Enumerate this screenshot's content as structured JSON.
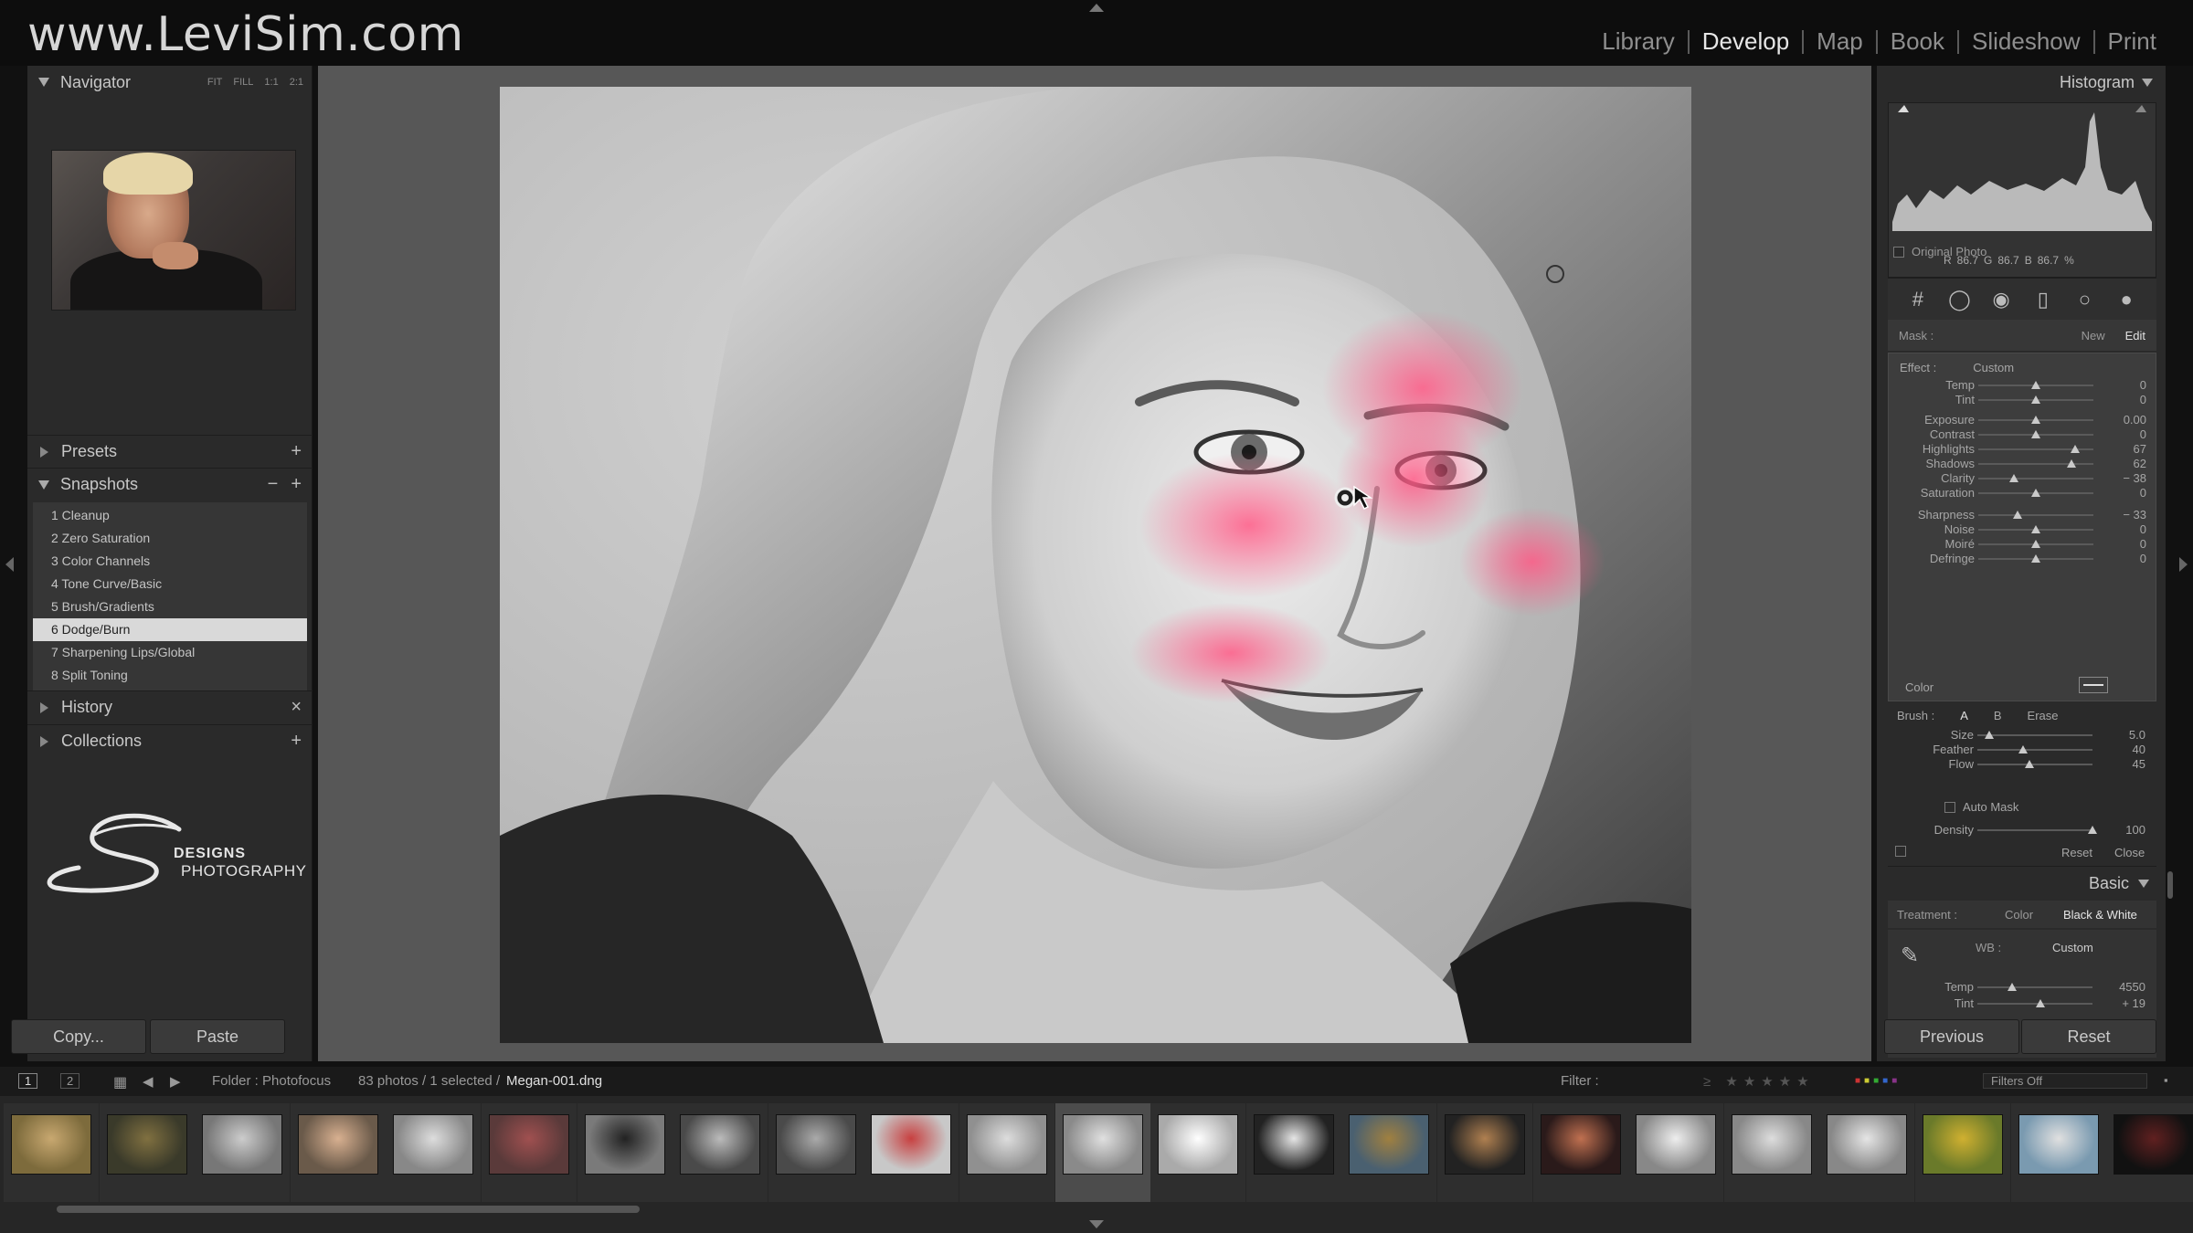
{
  "brand": "www.LeviSim.com",
  "modules": [
    "Library",
    "Develop",
    "Map",
    "Book",
    "Slideshow",
    "Print"
  ],
  "active_module": "Develop",
  "left_panel": {
    "navigator": {
      "title": "Navigator",
      "zoom_options": [
        "FIT",
        "FILL",
        "1:1",
        "2:1"
      ]
    },
    "presets": {
      "title": "Presets",
      "action": "+"
    },
    "snapshots": {
      "title": "Snapshots",
      "actions": [
        "−",
        "+"
      ],
      "items": [
        "1 Cleanup",
        "2 Zero Saturation",
        "3 Color Channels",
        "4 Tone Curve/Basic",
        "5 Brush/Gradients",
        "6 Dodge/Burn",
        "7 Sharpening Lips/Global",
        "8 Split Toning"
      ],
      "selected_index": 5
    },
    "history": {
      "title": "History",
      "action": "×"
    },
    "collections": {
      "title": "Collections",
      "action": "+"
    },
    "logo": {
      "line1": "DESIGNS",
      "line2": "PHOTOGRAPHY"
    },
    "copy_label": "Copy...",
    "paste_label": "Paste"
  },
  "right_panel": {
    "histogram": {
      "title": "Histogram",
      "readout": {
        "r_label": "R",
        "r": "86.7",
        "g_label": "G",
        "g": "86.7",
        "b_label": "B",
        "b": "86.7",
        "unit": "%"
      },
      "original_photo": "Original Photo"
    },
    "mask": {
      "label": "Mask :",
      "new": "New",
      "edit": "Edit"
    },
    "effect": {
      "label": "Effect :",
      "value": "Custom"
    },
    "sliders": [
      {
        "label": "Temp",
        "value": "0",
        "pos": 0.5
      },
      {
        "label": "Tint",
        "value": "0",
        "pos": 0.5
      },
      {
        "label": "Exposure",
        "value": "0.00",
        "pos": 0.5
      },
      {
        "label": "Contrast",
        "value": "0",
        "pos": 0.5
      },
      {
        "label": "Highlights",
        "value": "67",
        "pos": 0.84
      },
      {
        "label": "Shadows",
        "value": "62",
        "pos": 0.81
      },
      {
        "label": "Clarity",
        "value": "− 38",
        "pos": 0.31
      },
      {
        "label": "Saturation",
        "value": "0",
        "pos": 0.5
      },
      {
        "label": "Sharpness",
        "value": "− 33",
        "pos": 0.34
      },
      {
        "label": "Noise",
        "value": "0",
        "pos": 0.5
      },
      {
        "label": "Moiré",
        "value": "0",
        "pos": 0.5
      },
      {
        "label": "Defringe",
        "value": "0",
        "pos": 0.5
      }
    ],
    "color_label": "Color",
    "brush": {
      "label": "Brush :",
      "a": "A",
      "b": "B",
      "erase": "Erase",
      "sliders": [
        {
          "label": "Size",
          "value": "5.0",
          "pos": 0.1
        },
        {
          "label": "Feather",
          "value": "40",
          "pos": 0.4
        },
        {
          "label": "Flow",
          "value": "45",
          "pos": 0.45
        }
      ],
      "auto_mask": "Auto Mask",
      "density": {
        "label": "Density",
        "value": "100",
        "pos": 1.0
      }
    },
    "reset_label": "Reset",
    "close_label": "Close",
    "basic": {
      "title": "Basic",
      "treatment_label": "Treatment :",
      "color": "Color",
      "bw": "Black & White",
      "wb_label": "WB :",
      "wb_value": "Custom",
      "temp": {
        "label": "Temp",
        "value": "4550",
        "pos": 0.3
      },
      "tint": {
        "label": "Tint",
        "value": "+ 19",
        "pos": 0.55
      }
    },
    "previous_label": "Previous",
    "reset_button_label": "Reset"
  },
  "filmstrip_bar": {
    "page1": "1",
    "page2": "2",
    "folder": "Folder : Photofocus",
    "count": "83 photos / 1 selected /",
    "filename": "Megan-001.dng",
    "filter_label": "Filter :",
    "filters_off": "Filters Off"
  },
  "filmstrip": {
    "thumbnails": [
      {
        "color": "#7d6b3c",
        "accent": "#c8a870"
      },
      {
        "color": "#3a3a2a",
        "accent": "#807040"
      },
      {
        "color": "#777777",
        "accent": "#cccccc"
      },
      {
        "color": "#6a5a4a",
        "accent": "#d8b090"
      },
      {
        "color": "#888888",
        "accent": "#dddddd"
      },
      {
        "color": "#5a3a3a",
        "accent": "#a05050"
      },
      {
        "color": "#7a7a7a",
        "accent": "#222222"
      },
      {
        "color": "#4a4a4a",
        "accent": "#bbbbbb"
      },
      {
        "color": "#4a4a4a",
        "accent": "#aaaaaa"
      },
      {
        "color": "#c8c8c8",
        "accent": "#c84040"
      },
      {
        "color": "#909090",
        "accent": "#dddddd"
      },
      {
        "color": "#8a8a8a",
        "accent": "#e0e0e0"
      },
      {
        "color": "#aaaaaa",
        "accent": "#ffffff"
      },
      {
        "color": "#222222",
        "accent": "#e6e6e6"
      },
      {
        "color": "#4a6070",
        "accent": "#a08040"
      },
      {
        "color": "#222222",
        "accent": "#b08050"
      },
      {
        "color": "#2a1a1a",
        "accent": "#c07050"
      },
      {
        "color": "#888888",
        "accent": "#eeeeee"
      },
      {
        "color": "#888888",
        "accent": "#dddddd"
      },
      {
        "color": "#888888",
        "accent": "#e5e5e5"
      },
      {
        "color": "#6a7a2a",
        "accent": "#d0b030"
      },
      {
        "color": "#7a9ab0",
        "accent": "#e0e0e0"
      },
      {
        "color": "#111111",
        "accent": "#602020"
      }
    ],
    "selected_index": 11
  }
}
